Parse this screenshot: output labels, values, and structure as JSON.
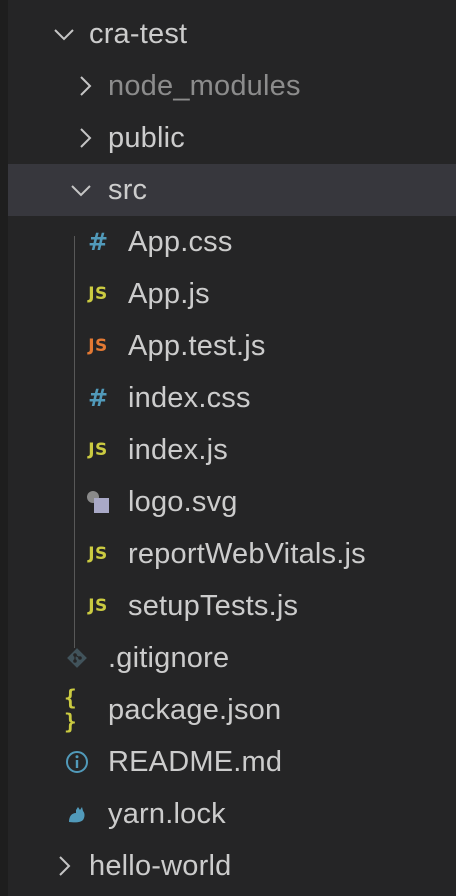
{
  "explorer": {
    "items": [
      {
        "label": "cra-test",
        "type": "folder",
        "state": "expanded"
      },
      {
        "label": "node_modules",
        "type": "folder",
        "state": "collapsed"
      },
      {
        "label": "public",
        "type": "folder",
        "state": "collapsed"
      },
      {
        "label": "src",
        "type": "folder",
        "state": "expanded",
        "selected": true
      },
      {
        "label": "App.css",
        "type": "file",
        "icon": "css-hash-icon",
        "icon_text": "#"
      },
      {
        "label": "App.js",
        "type": "file",
        "icon": "js-icon",
        "icon_text": "JS"
      },
      {
        "label": "App.test.js",
        "type": "file",
        "icon": "js-test-icon",
        "icon_text": "JS"
      },
      {
        "label": "index.css",
        "type": "file",
        "icon": "css-hash-icon",
        "icon_text": "#"
      },
      {
        "label": "index.js",
        "type": "file",
        "icon": "js-icon",
        "icon_text": "JS"
      },
      {
        "label": "logo.svg",
        "type": "file",
        "icon": "svg-image-icon"
      },
      {
        "label": "reportWebVitals.js",
        "type": "file",
        "icon": "js-icon",
        "icon_text": "JS"
      },
      {
        "label": "setupTests.js",
        "type": "file",
        "icon": "js-icon",
        "icon_text": "JS"
      },
      {
        "label": ".gitignore",
        "type": "file",
        "icon": "git-icon"
      },
      {
        "label": "package.json",
        "type": "file",
        "icon": "json-braces-icon",
        "icon_text": "{ }"
      },
      {
        "label": "README.md",
        "type": "file",
        "icon": "info-icon"
      },
      {
        "label": "yarn.lock",
        "type": "file",
        "icon": "yarn-cat-icon"
      },
      {
        "label": "hello-world",
        "type": "folder",
        "state": "collapsed"
      }
    ]
  },
  "colors": {
    "background": "#252526",
    "selected_row": "#37373d",
    "text": "#cccccc",
    "dimmed_text": "#8c8c8c",
    "css_icon": "#519aba",
    "js_icon": "#cbcb41",
    "js_test_icon": "#e37933",
    "svg_icon": "#a074c4",
    "git_icon": "#41535b"
  }
}
